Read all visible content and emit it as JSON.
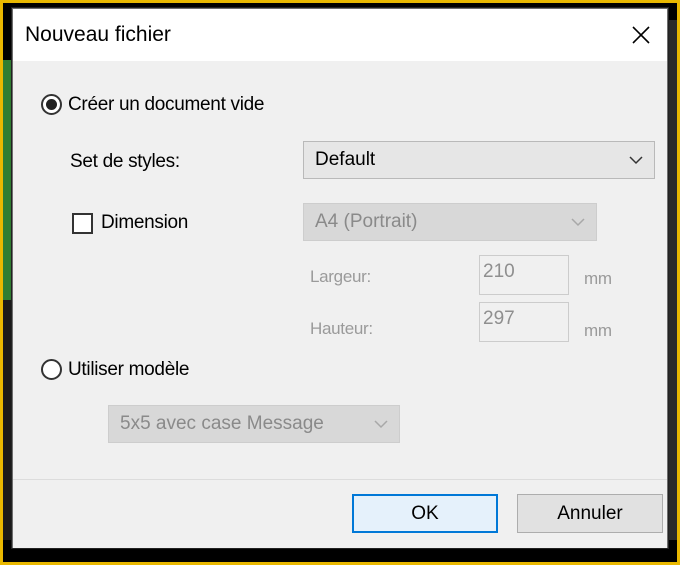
{
  "dialog": {
    "title": "Nouveau fichier",
    "close_glyph": "×"
  },
  "options": {
    "blank_document_label": "Créer un document vide",
    "blank_document_selected": true,
    "style_set_label": "Set de styles:",
    "style_set_value": "Default",
    "dimension_label": "Dimension",
    "dimension_checked": false,
    "dimension_value": "A4 (Portrait)",
    "width_label": "Largeur:",
    "width_value": "210",
    "width_unit": "mm",
    "height_label": "Hauteur:",
    "height_value": "297",
    "height_unit": "mm",
    "use_template_label": "Utiliser modèle",
    "use_template_selected": false,
    "template_value": "5x5 avec case Message"
  },
  "footer": {
    "ok_label": "OK",
    "cancel_label": "Annuler"
  },
  "icons": {
    "close": "close-icon",
    "chevron": "chevron-down-icon"
  }
}
